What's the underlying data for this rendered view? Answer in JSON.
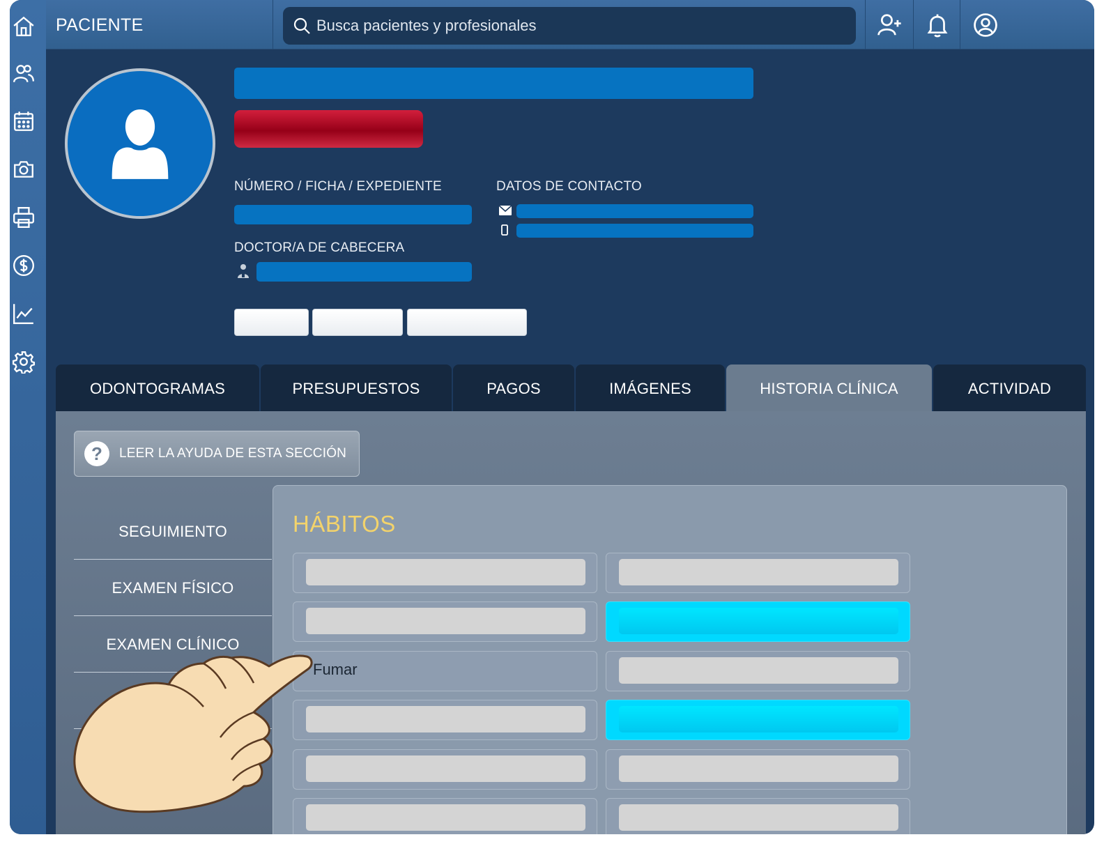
{
  "topbar": {
    "title": "PACIENTE",
    "search_placeholder": "Busca pacientes y profesionales"
  },
  "patient": {
    "number_label": "NÚMERO / FICHA / EXPEDIENTE",
    "contact_label": "DATOS DE CONTACTO",
    "doctor_label": "DOCTOR/A DE CABECERA"
  },
  "tabs": [
    {
      "label": "ODONTOGRAMAS"
    },
    {
      "label": "PRESUPUESTOS"
    },
    {
      "label": "PAGOS"
    },
    {
      "label": "IMÁGENES"
    },
    {
      "label": "HISTORIA CLÍNICA",
      "active": true
    },
    {
      "label": "ACTIVIDAD"
    }
  ],
  "help": {
    "label": "LEER LA AYUDA DE ESTA SECCIÓN"
  },
  "subnav": [
    {
      "label": "SEGUIMIENTO"
    },
    {
      "label": "EXAMEN FÍSICO"
    },
    {
      "label": "EXAMEN CLÍNICO"
    }
  ],
  "habits": {
    "title": "HÁBITOS",
    "highlighted_item": "Fumar"
  },
  "colors": {
    "accent_blue": "#0673c1",
    "alert_red": "#960018",
    "highlight_cyan": "#00d9ff",
    "section_title": "#f3d36b"
  }
}
